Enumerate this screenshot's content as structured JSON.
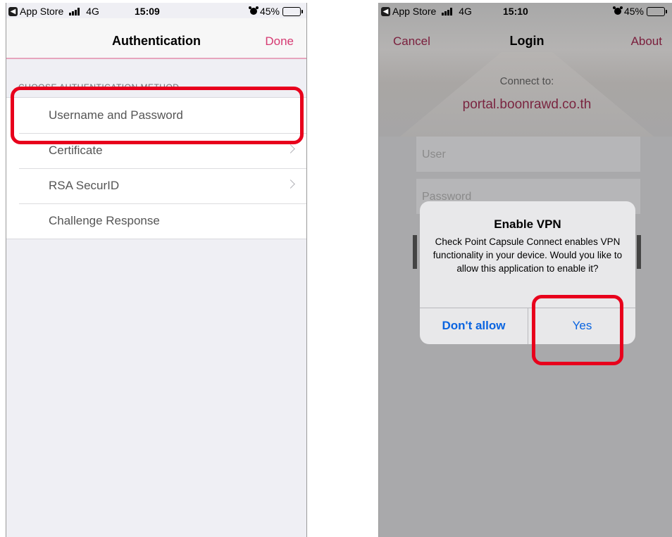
{
  "left_screen": {
    "status": {
      "app_label": "App Store",
      "network": "4G",
      "time": "15:09",
      "battery": "45%",
      "battery_level": 0.45
    },
    "nav": {
      "title": "Authentication",
      "done_label": "Done"
    },
    "section_header": "CHOOSE AUTHENTICATION METHOD",
    "items": [
      {
        "label": "Username and Password",
        "chevron": false
      },
      {
        "label": "Certificate",
        "chevron": true
      },
      {
        "label": "RSA SecurID",
        "chevron": true
      },
      {
        "label": "Challenge Response",
        "chevron": false
      }
    ]
  },
  "right_screen": {
    "status": {
      "app_label": "App Store",
      "network": "4G",
      "time": "15:10",
      "battery": "45%",
      "battery_level": 0.45
    },
    "nav": {
      "cancel_label": "Cancel",
      "title": "Login",
      "about_label": "About"
    },
    "connect_label": "Connect to:",
    "portal": "portal.boonrawd.co.th",
    "user_placeholder": "User",
    "password_placeholder": "Password",
    "alert": {
      "title": "Enable VPN",
      "message": "Check Point Capsule Connect enables VPN functionality in your device. Would you like to allow this application to enable it?",
      "deny_label": "Don't allow",
      "allow_label": "Yes"
    }
  },
  "colors": {
    "accent": "#d63a72",
    "alert_button": "#0a64e0",
    "highlight": "#e8001c"
  }
}
